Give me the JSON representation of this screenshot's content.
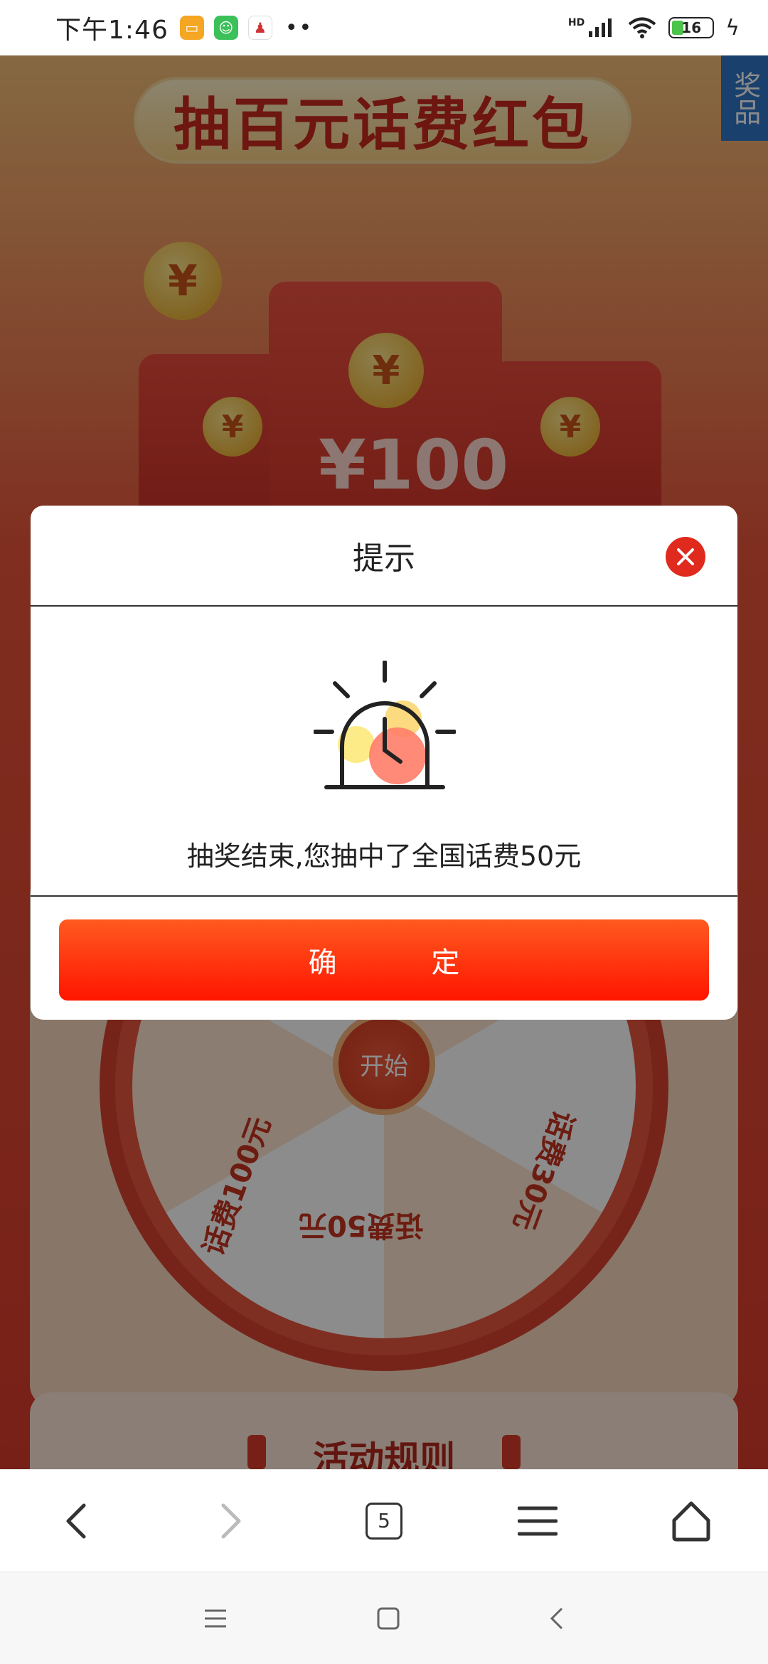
{
  "status": {
    "time": "下午1:46",
    "network": "HD",
    "battery": "16"
  },
  "page": {
    "banner_title": "抽百元话费红包",
    "side_tab": "奖品",
    "amount": "¥100",
    "wheel_labels": [
      "话费100元",
      "话费50元",
      "话费30元"
    ],
    "start_label": "开始",
    "rules_title": "活动规则"
  },
  "modal": {
    "title": "提示",
    "message": "抽奖结束,您抽中了全国话费50元",
    "confirm_label": "确 定"
  },
  "browser": {
    "tab_count": "5"
  },
  "colors": {
    "accent": "#ff2a0a",
    "close": "#e02a1d"
  }
}
